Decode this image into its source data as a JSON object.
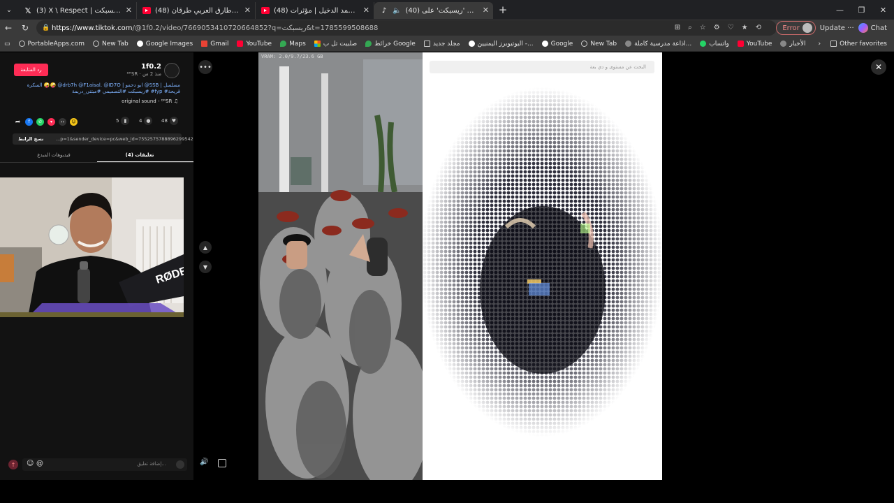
{
  "tabs": [
    {
      "title": "(3) X \\ Respect | ريسبكت (@Resspect)",
      "icon": "x-icon",
      "active": false
    },
    {
      "title": "(48) صقور الارض | طارق العربي طرقان",
      "icon": "youtube-icon",
      "active": false
    },
    {
      "title": "(48) شيلة مشينا | محمد الدخيل | مؤثرات",
      "icon": "youtube-icon",
      "active": false
    },
    {
      "title": "(40) اعثر على 'ريسبكت' على TikTok",
      "icon": "tiktok-icon",
      "active": true
    }
  ],
  "window": {
    "minimize": "—",
    "restore": "❐",
    "close": "✕"
  },
  "address": {
    "url_host": "https://www.tiktok.com",
    "url_path": "/@1f0.2/video/7669053410720664852?q=ريسبكت&t=1785599508688",
    "error_label": "Error",
    "update_label": "Update",
    "chat_label": "Chat"
  },
  "bookmarks": [
    {
      "label": "PortableApps.com",
      "icon": "globe-icon"
    },
    {
      "label": "New Tab",
      "icon": "globe-icon"
    },
    {
      "label": "Google Images",
      "icon": "google-icon"
    },
    {
      "label": "Gmail",
      "icon": "gmail-icon"
    },
    {
      "label": "YouTube",
      "icon": "youtube-icon"
    },
    {
      "label": "Maps",
      "icon": "maps-icon"
    },
    {
      "label": "صلبيت تل ب",
      "icon": "ms-icon"
    },
    {
      "label": "خرائط Google",
      "icon": "maps-icon"
    },
    {
      "label": "مجلد جديد",
      "icon": "folder-icon"
    },
    {
      "label": "اليوتيوبرز اليمنيين -...",
      "icon": "google-icon"
    },
    {
      "label": "Google",
      "icon": "google-icon"
    },
    {
      "label": "New Tab",
      "icon": "globe-icon"
    },
    {
      "label": "اذاعة مدرسية كاملة...",
      "icon": "leaf-icon"
    },
    {
      "label": "واتساب",
      "icon": "whatsapp-icon"
    },
    {
      "label": "YouTube",
      "icon": "youtube-icon"
    },
    {
      "label": "الأخبار",
      "icon": "news-icon"
    }
  ],
  "other_favorites": "Other favorites",
  "post": {
    "author": "1f0.2",
    "author_sub": "ᴰᴿSR · منذ 2 س",
    "follow_label": "رد المتابعة",
    "description": "السكرة 🤪🤪 @drb7h ‎@F1aisal. ‎@ID7O | ابو دحمو @SSB | مسلسل #ريسبكت #التصميمي #مبتني_دريمة #fyp #قريحة",
    "sound": "original sound - ᴰᴿSR ♫",
    "likes": "48",
    "comments": "4",
    "saves": "5",
    "link_copy": "نسخ الرابط",
    "link_url": "...p=1&sender_device=pc&web_id=7552575788896299542",
    "tab_comments": "تعليقات (4)",
    "tab_creator": "فيديوهات المبدع"
  },
  "comment_input": {
    "placeholder": "إضافة تعليق..."
  },
  "webcam": {
    "mic_brand": "RØDE"
  },
  "video": {
    "overlay_text": "VRAM: 2.0/9.7/23.6 GB",
    "search_placeholder": "البحث عن مستوى و دي بعة"
  }
}
